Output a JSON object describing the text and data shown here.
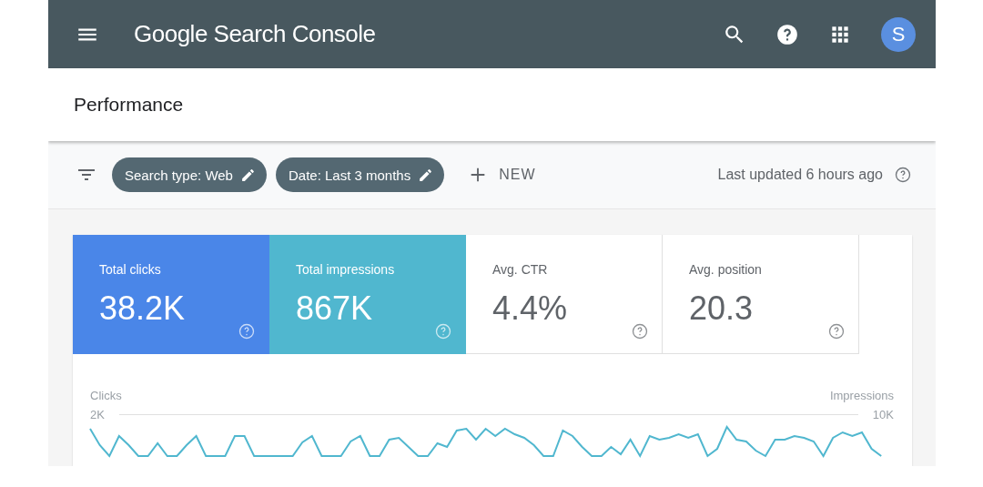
{
  "header": {
    "title": "Google Search Console",
    "avatar_letter": "S"
  },
  "page": {
    "title": "Performance"
  },
  "filters": {
    "chips": [
      {
        "label": "Search type: Web"
      },
      {
        "label": "Date: Last 3 months"
      }
    ],
    "new_label": "NEW",
    "last_updated": "Last updated 6 hours ago"
  },
  "metrics": [
    {
      "label": "Total clicks",
      "value": "38.2K",
      "selected": true,
      "color": "#4a86e8"
    },
    {
      "label": "Total impressions",
      "value": "867K",
      "selected": true,
      "color": "#50b7cf"
    },
    {
      "label": "Avg. CTR",
      "value": "4.4%",
      "selected": false,
      "color": "#5f6368"
    },
    {
      "label": "Avg. position",
      "value": "20.3",
      "selected": false,
      "color": "#5f6368"
    }
  ],
  "chart": {
    "left_label": "Clicks",
    "left_tick": "2K",
    "right_label": "Impressions",
    "right_tick": "10K"
  }
}
